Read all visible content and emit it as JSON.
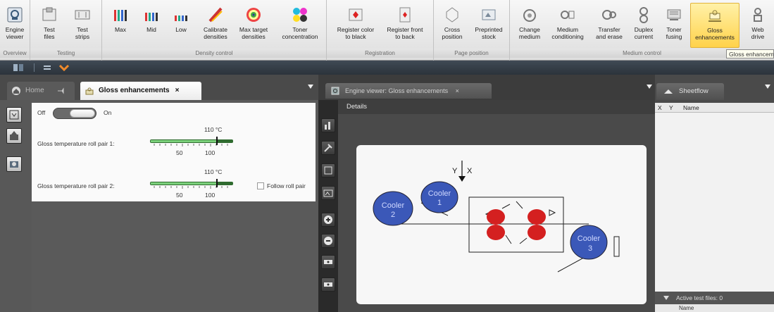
{
  "ribbon": {
    "groups": [
      {
        "label": "Overview",
        "buttons": [
          {
            "label": "Engine\nviewer",
            "icon": "engine-viewer-icon"
          }
        ]
      },
      {
        "label": "Testing",
        "buttons": [
          {
            "label": "Test\nfiles",
            "icon": "test-files-icon"
          },
          {
            "label": "Test\nstrips",
            "icon": "test-strips-icon"
          }
        ]
      },
      {
        "label": "Density control",
        "buttons": [
          {
            "label": "Max",
            "icon": "max-icon"
          },
          {
            "label": "Mid",
            "icon": "mid-icon"
          },
          {
            "label": "Low",
            "icon": "low-icon"
          },
          {
            "label": "Calibrate\ndensities",
            "icon": "calibrate-icon"
          },
          {
            "label": "Max target\ndensities",
            "icon": "target-icon"
          },
          {
            "label": "Toner\nconcentration",
            "icon": "toner-concentration-icon"
          }
        ]
      },
      {
        "label": "Registration",
        "buttons": [
          {
            "label": "Register color\nto black",
            "icon": "register-color-icon"
          },
          {
            "label": "Register front\nto back",
            "icon": "register-front-icon"
          }
        ]
      },
      {
        "label": "Page position",
        "buttons": [
          {
            "label": "Cross\nposition",
            "icon": "cross-position-icon"
          },
          {
            "label": "Preprinted\nstock",
            "icon": "preprinted-stock-icon"
          }
        ]
      },
      {
        "label": "Medium control",
        "buttons": [
          {
            "label": "Change\nmedium",
            "icon": "change-medium-icon"
          },
          {
            "label": "Medium\nconditioning",
            "icon": "medium-conditioning-icon"
          },
          {
            "label": "Transfer\nand erase",
            "icon": "transfer-erase-icon"
          },
          {
            "label": "Duplex\ncurrent",
            "icon": "duplex-current-icon"
          },
          {
            "label": "Toner\nfusing",
            "icon": "toner-fusing-icon"
          },
          {
            "label": "Gloss\nenhancements",
            "icon": "gloss-icon"
          },
          {
            "label": "Web\ndrive",
            "icon": "web-drive-icon"
          }
        ]
      }
    ],
    "tooltip": "Gloss enhancements"
  },
  "left_panel": {
    "tabs": [
      {
        "label": "Home",
        "icon": "home-icon"
      },
      {
        "label": "Gloss enhancements",
        "close": "×",
        "icon": "gloss-tab-icon"
      }
    ],
    "toggle": {
      "off_label": "Off",
      "on_label": "On",
      "state": "on"
    },
    "rows": [
      {
        "label": "Gloss temperature roll pair 1:",
        "value": "110 °C",
        "tick_min": "50",
        "tick_max": "100"
      },
      {
        "label": "Gloss temperature roll pair 2:",
        "value": "110 °C",
        "tick_min": "50",
        "tick_max": "100"
      }
    ],
    "follow_label": "Follow roll pair"
  },
  "viewer": {
    "tab_label": "Engine viewer: Gloss enhancements",
    "tab_close": "×",
    "details_label": "Details",
    "axis_y": "Y",
    "axis_x": "X",
    "coolers": [
      {
        "line1": "Cooler",
        "line2": "2"
      },
      {
        "line1": "Cooler",
        "line2": "1"
      },
      {
        "line1": "Cooler",
        "line2": "3"
      }
    ]
  },
  "sheetflow": {
    "tab_label": "Sheetflow",
    "columns": [
      "X",
      "Y",
      "Name"
    ],
    "active_files": "Active test files: 0",
    "active_column": "Name"
  },
  "colors": {
    "cooler_blue": "#3b58b8",
    "roller_red": "#d42020",
    "active_button": "#ffd24a"
  }
}
